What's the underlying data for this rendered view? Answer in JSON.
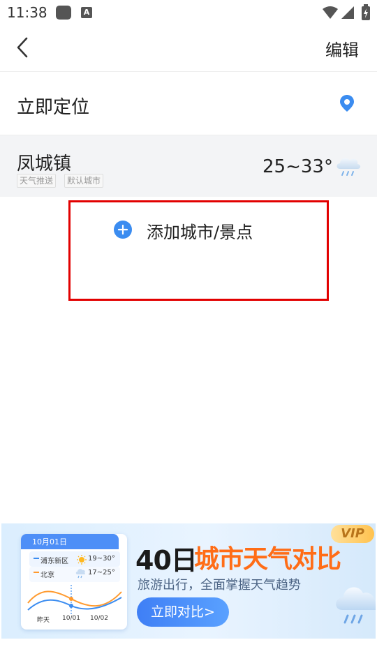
{
  "status_bar": {
    "time": "11:38",
    "app_icon_letter": "A"
  },
  "header": {
    "edit_label": "编辑"
  },
  "locate": {
    "label": "立即定位"
  },
  "city": {
    "name": "凤城镇",
    "tags": [
      "天气推送",
      "默认城市"
    ],
    "temp_range": "25~33°",
    "weather_icon": "cloud-rain-icon"
  },
  "add_city": {
    "label": "添加城市/景点"
  },
  "banner": {
    "card": {
      "date": "10月01日",
      "rows": [
        {
          "city": "浦东新区",
          "temp": "19~30°",
          "icon": "sun-icon"
        },
        {
          "city": "北京",
          "temp": "17~25°",
          "icon": "cloud-rain-icon"
        }
      ],
      "x_labels": [
        "昨天",
        "10/01",
        "10/02"
      ]
    },
    "title_prefix": "40日",
    "title_highlight": "城市天气对比",
    "subtitle": "旅游出行，全面掌握天气趋势",
    "button_label": "立即对比>",
    "vip_label": "VIP"
  },
  "colors": {
    "accent_blue": "#3b8cf0",
    "highlight_red": "#e20000",
    "title_orange": "#ff6d17"
  }
}
